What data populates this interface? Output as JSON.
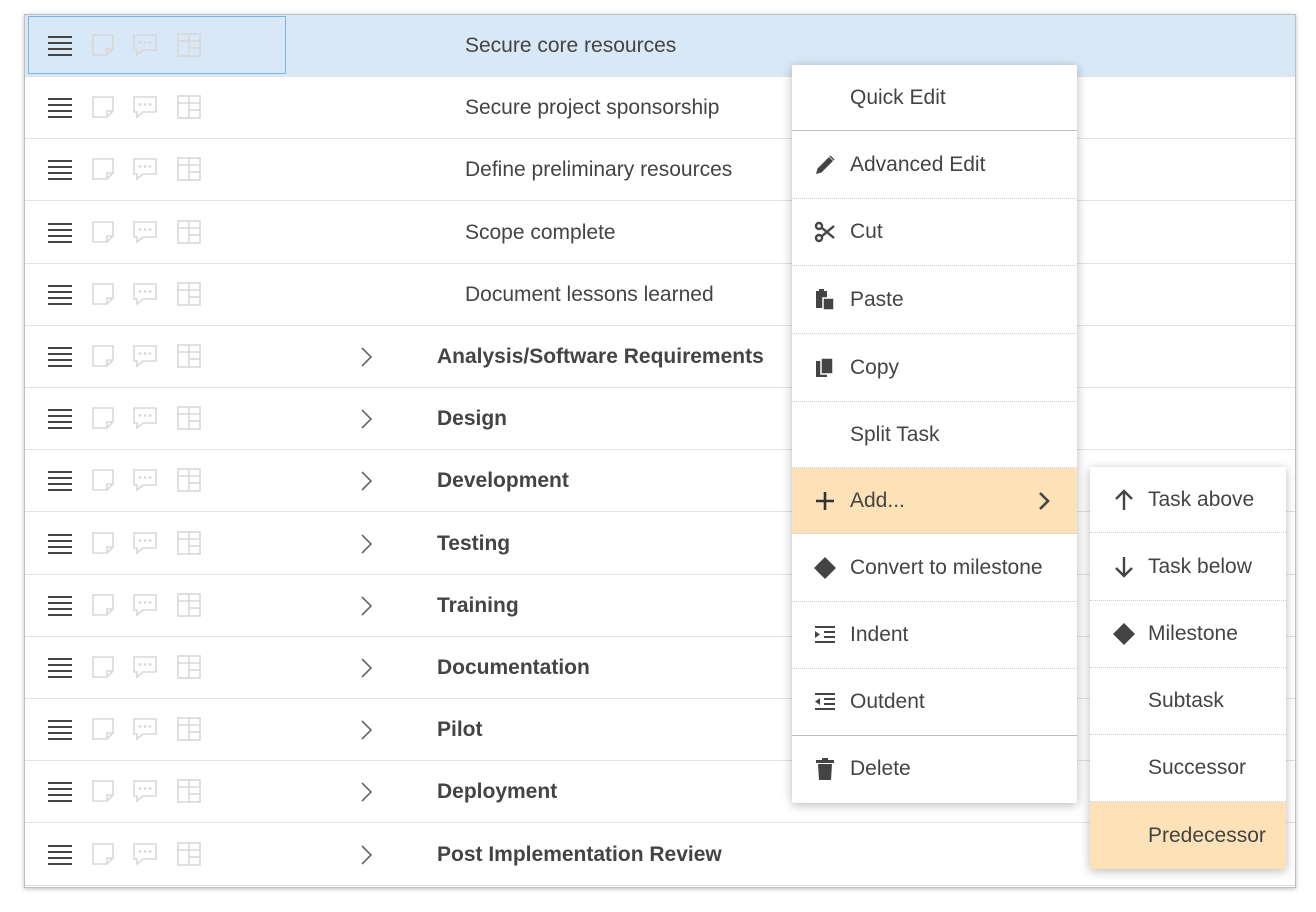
{
  "rows": [
    {
      "label": "Secure core resources",
      "kind": "sub",
      "selected": true
    },
    {
      "label": "Secure project sponsorship",
      "kind": "sub"
    },
    {
      "label": "Define preliminary resources",
      "kind": "sub"
    },
    {
      "label": "Scope complete",
      "kind": "sub"
    },
    {
      "label": "Document lessons learned",
      "kind": "sub"
    },
    {
      "label": "Analysis/Software Requirements",
      "kind": "group"
    },
    {
      "label": "Design",
      "kind": "group"
    },
    {
      "label": "Development",
      "kind": "group"
    },
    {
      "label": "Testing",
      "kind": "group"
    },
    {
      "label": "Training",
      "kind": "group"
    },
    {
      "label": "Documentation",
      "kind": "group"
    },
    {
      "label": "Pilot",
      "kind": "group"
    },
    {
      "label": "Deployment",
      "kind": "group"
    },
    {
      "label": "Post Implementation Review",
      "kind": "group"
    }
  ],
  "row_icons": [
    "menu-icon",
    "note-icon",
    "comment-icon",
    "details-icon"
  ],
  "context_menu": {
    "items": [
      {
        "label": "Quick Edit",
        "icon": ""
      },
      {
        "label": "Advanced Edit",
        "icon": "pencil-icon"
      },
      {
        "label": "Cut",
        "icon": "scissors-icon"
      },
      {
        "label": "Paste",
        "icon": "paste-icon"
      },
      {
        "label": "Copy",
        "icon": "copy-icon"
      },
      {
        "label": "Split Task",
        "icon": ""
      },
      {
        "label": "Add...",
        "icon": "plus-icon",
        "highlighted": true,
        "has_submenu": true
      },
      {
        "label": "Convert to milestone",
        "icon": "diamond-icon"
      },
      {
        "label": "Indent",
        "icon": "indent-icon"
      },
      {
        "label": "Outdent",
        "icon": "outdent-icon"
      },
      {
        "label": "Delete",
        "icon": "trash-icon"
      }
    ]
  },
  "submenu": {
    "items": [
      {
        "label": "Task above",
        "icon": "arrow-up-icon"
      },
      {
        "label": "Task below",
        "icon": "arrow-down-icon"
      },
      {
        "label": "Milestone",
        "icon": "diamond-icon"
      },
      {
        "label": "Subtask",
        "icon": ""
      },
      {
        "label": "Successor",
        "icon": ""
      },
      {
        "label": "Predecessor",
        "icon": "",
        "highlighted": true
      }
    ]
  },
  "colors": {
    "selected_row": "#d9e8f6",
    "menu_highlight": "#fde2b8",
    "icon_dark": "#444444",
    "icon_faint": "#d8d8d8"
  }
}
